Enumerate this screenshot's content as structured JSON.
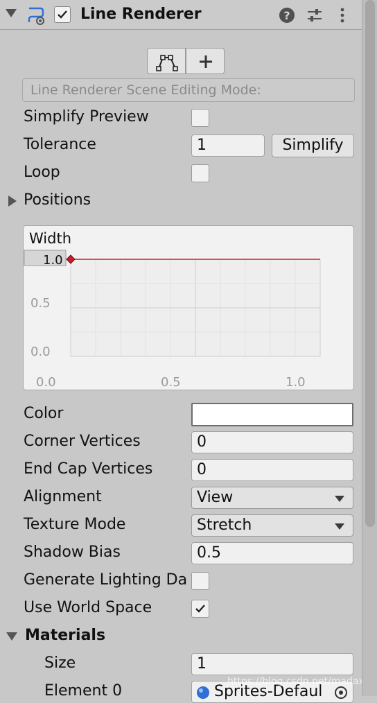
{
  "component": {
    "title": "Line Renderer",
    "enabled": true,
    "icons": [
      "line-renderer-icon",
      "help-icon",
      "preset-icon",
      "more-menu-icon"
    ]
  },
  "editing": {
    "mode_label": "Line Renderer Scene Editing Mode:",
    "buttons": [
      "edit-points-icon",
      "add-point-icon"
    ]
  },
  "fields": {
    "simplify_preview": {
      "label": "Simplify Preview",
      "checked": false
    },
    "tolerance": {
      "label": "Tolerance",
      "value": "1",
      "button": "Simplify"
    },
    "loop": {
      "label": "Loop",
      "checked": false
    },
    "positions": {
      "label": "Positions",
      "expanded": false
    }
  },
  "width_curve": {
    "title": "Width",
    "y_ticks": [
      "1.0",
      "0.5",
      "0.0"
    ],
    "x_ticks": [
      "0.0",
      "0.5",
      "1.0"
    ],
    "key_value": 1.0,
    "line_color": "#c81e2a"
  },
  "props": {
    "color": {
      "label": "Color",
      "value_color": "#ffffff"
    },
    "corner_vertices": {
      "label": "Corner Vertices",
      "value": "0"
    },
    "end_cap_vertices": {
      "label": "End Cap Vertices",
      "value": "0"
    },
    "alignment": {
      "label": "Alignment",
      "value": "View"
    },
    "texture_mode": {
      "label": "Texture Mode",
      "value": "Stretch"
    },
    "shadow_bias": {
      "label": "Shadow Bias",
      "value": "0.5"
    },
    "generate_lighting": {
      "label": "Generate Lighting Da",
      "checked": false
    },
    "use_world_space": {
      "label": "Use World Space",
      "checked": true
    }
  },
  "materials": {
    "label": "Materials",
    "expanded": true,
    "size_label": "Size",
    "size_value": "1",
    "element0_label": "Element 0",
    "element0_value": "Sprites-Defaul"
  },
  "watermark": "https://blog.csdn.net/madaxin"
}
